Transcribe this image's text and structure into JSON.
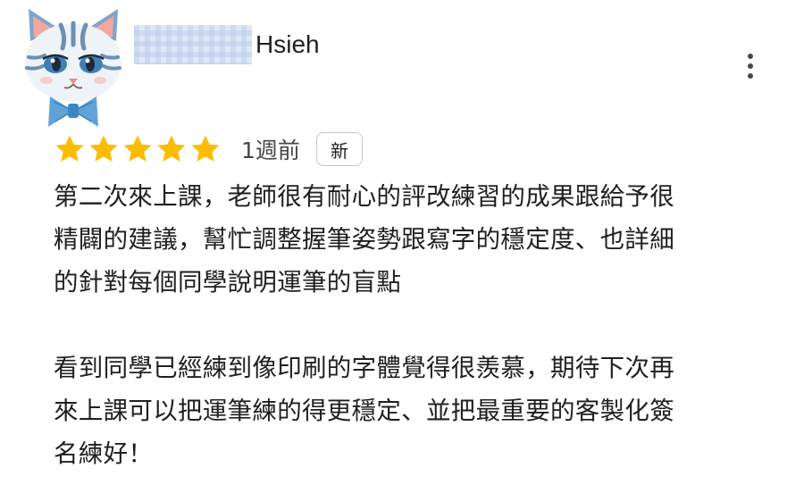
{
  "reviewer": {
    "name": "Hsieh",
    "avatar_icon": "cat-with-bow-avatar-icon"
  },
  "rating": {
    "stars": 5,
    "max_stars": 5,
    "star_color": "#fbbc04",
    "time": "1週前",
    "badge": "新"
  },
  "review": {
    "paragraph_1": "第二次來上課，老師很有耐心的評改練習的成果跟給予很\n精闢的建議，幫忙調整握筆姿勢跟寫字的穩定度、也詳細\n的針對每個同學說明運筆的盲點",
    "paragraph_2": "看到同學已經練到像印刷的字體覺得很羨慕，期待下次再\n來上課可以把運筆練的得更穩定、並把最重要的客製化簽\n名練好！"
  },
  "menu": {
    "icon": "more-vert-icon"
  }
}
